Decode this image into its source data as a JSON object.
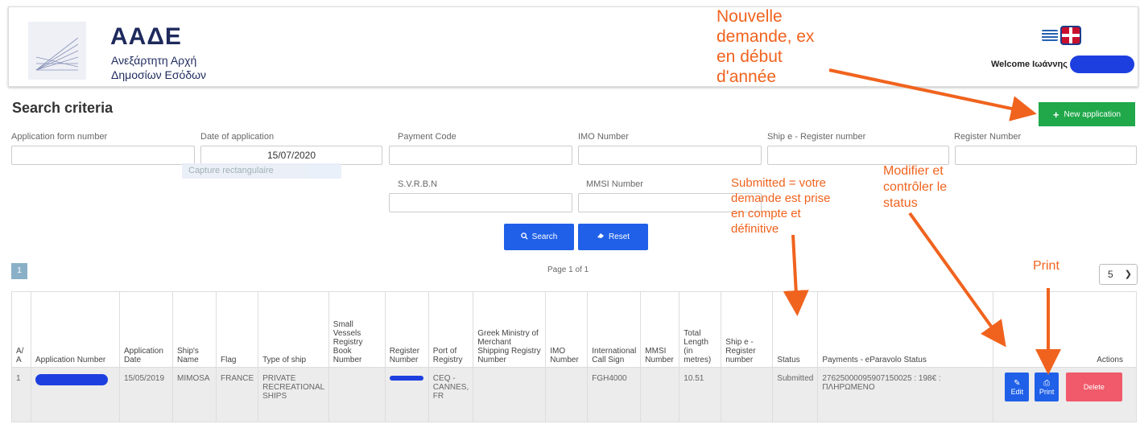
{
  "header": {
    "org_short": "ΑΑΔΕ",
    "org_line1": "Ανεξάρτητη Αρχή",
    "org_line2": "Δημοσίων Εσόδων",
    "welcome": "Welcome Ιωάννης"
  },
  "search": {
    "title": "Search criteria",
    "new_application": "New application",
    "fields": {
      "application_form_number": {
        "label": "Application form number",
        "value": ""
      },
      "date_of_application": {
        "label": "Date of application",
        "value": "15/07/2020"
      },
      "payment_code": {
        "label": "Payment Code",
        "value": ""
      },
      "imo_number": {
        "label": "IMO Number",
        "value": ""
      },
      "ship_e_register_number": {
        "label": "Ship e - Register number",
        "value": ""
      },
      "register_number": {
        "label": "Register Number",
        "value": ""
      },
      "svrbn": {
        "label": "S.V.R.B.N",
        "value": ""
      },
      "mmsi_number": {
        "label": "MMSI Number",
        "value": ""
      }
    },
    "capture_tip": "Capture rectangulaire",
    "search_button": "Search",
    "reset_button": "Reset"
  },
  "pagination": {
    "current_page": "1",
    "page_info": "Page 1 of 1",
    "page_size": "5"
  },
  "table": {
    "headers": [
      "A/ A",
      "Application Number",
      "Application Date",
      "Ship's Name",
      "Flag",
      "Type of ship",
      "Small Vessels Registry Book Number",
      "Register Number",
      "Port of Registry",
      "Greek Ministry of Merchant Shipping Registry Number",
      "IMO Number",
      "International Call Sign",
      "MMSI Number",
      "Total Length (in metres)",
      "Ship e - Register number",
      "Status",
      "Payments - eParavolo Status",
      "Actions"
    ],
    "rows": [
      {
        "aa": "1",
        "application_date": "15/05/2019",
        "ships_name": "MIMOSA",
        "flag": "FRANCE",
        "type_of_ship": "PRIVATE RECREATIONAL SHIPS",
        "port_of_registry": "CEQ - CANNES, FR",
        "call_sign": "FGH4000",
        "total_length": "10.51",
        "status": "Submitted",
        "payment": "27625000095907150025 : 198€ : ΠΛΗΡΩΜΕΝΟ",
        "edit_label": "Edit",
        "print_label": "Print",
        "delete_label": "Delete"
      }
    ]
  },
  "annotations": {
    "new_request": [
      "Nouvelle",
      "demande, ex",
      "en début",
      "d'année"
    ],
    "submitted": [
      "Submitted = votre",
      "demande est prise",
      "en compte et",
      "définitive"
    ],
    "modify": [
      "Modifier et",
      "contrôler le",
      "status"
    ],
    "print": "Print"
  },
  "colors": {
    "accent_green": "#20a84a",
    "button_blue": "#2060e8",
    "delete_red": "#f05a6a",
    "annotation_orange": "#f0631e",
    "redaction_blue": "#1d3fe0"
  }
}
